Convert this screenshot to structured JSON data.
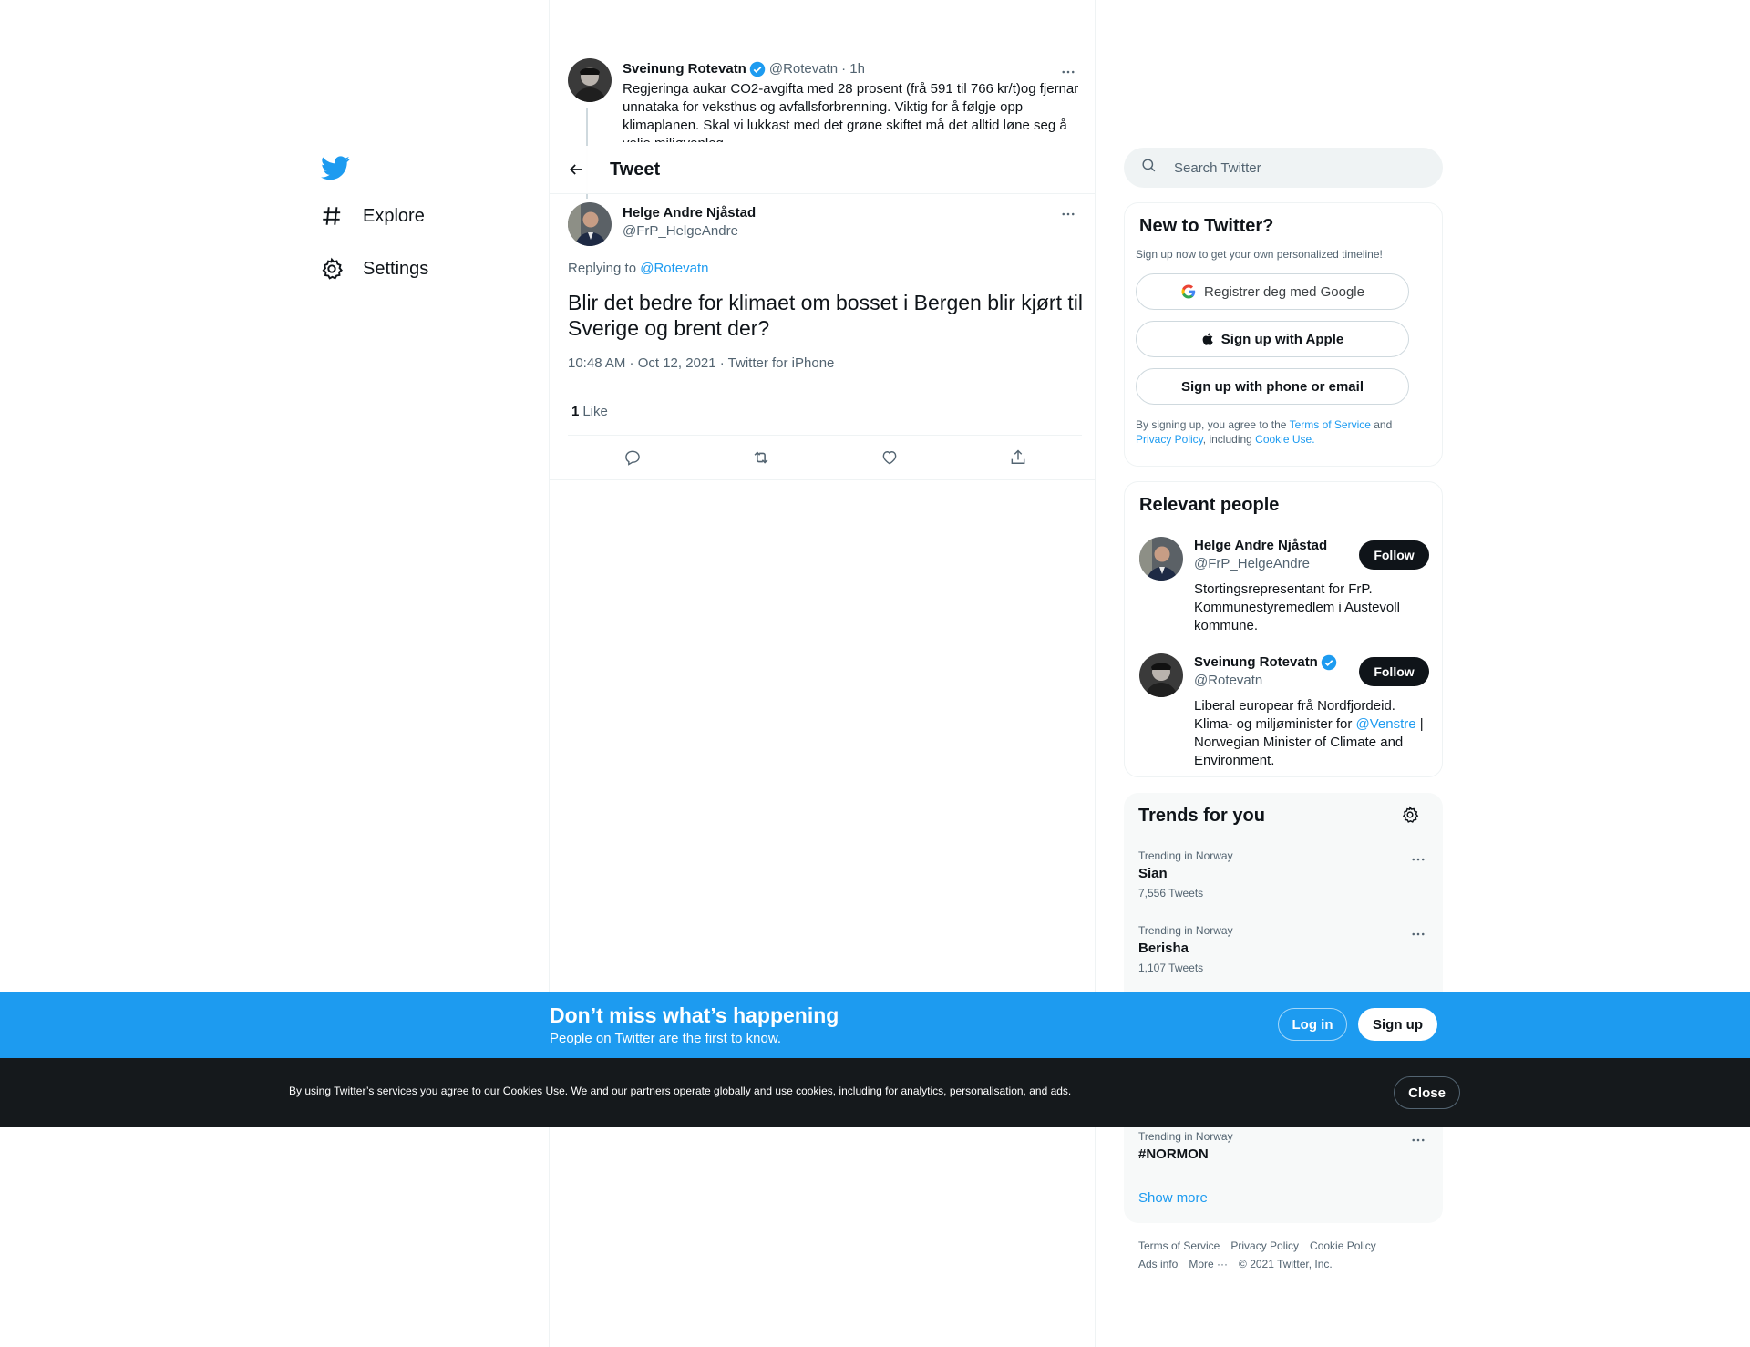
{
  "nav": {
    "items": [
      {
        "label": "Explore",
        "icon": "hash-icon"
      },
      {
        "label": "Settings",
        "icon": "gear-icon"
      }
    ]
  },
  "parent_tweet": {
    "name": "Sveinung Rotevatn",
    "handle": "@Rotevatn",
    "time": "· 1h",
    "text": "Regjeringa aukar CO2-avgifta med 28 prosent (frå 591 til 766 kr/t)og fjernar unnataka for veksthus og avfallsforbrenning. Viktig for å følgje opp klimaplanen. Skal vi lukkast med det grøne skiftet må det alltid løne seg å velje miljøvenleg."
  },
  "header": {
    "title": "Tweet"
  },
  "tweet": {
    "name": "Helge Andre Njåstad",
    "handle": "@FrP_HelgeAndre",
    "replying_prefix": "Replying to ",
    "replying_to": "@Rotevatn",
    "text": "Blir det bedre for klimaet om bosset i Bergen blir kjørt til Sverige og brent der?",
    "timestamp": "10:48 AM · Oct 12, 2021 · Twitter for iPhone",
    "like_count": "1",
    "like_label": "Like"
  },
  "search": {
    "placeholder": "Search Twitter"
  },
  "new_to_twitter": {
    "title": "New to Twitter?",
    "subtitle": "Sign up now to get your own personalized timeline!",
    "google_button": "Registrer deg med Google",
    "apple_button": "Sign up with Apple",
    "phone_button": "Sign up with phone or email",
    "legal_prefix": "By signing up, you agree to the ",
    "terms": "Terms of Service",
    "and": " and",
    "privacy": "Privacy Policy",
    "including": ", including ",
    "cookie": "Cookie Use."
  },
  "relevant_people": {
    "title": "Relevant people",
    "people": [
      {
        "name": "Helge Andre Njåstad",
        "handle": "@FrP_HelgeAndre",
        "bio": "Stortingsrepresentant for FrP. Kommunestyremedlem i Austevoll kommune.",
        "follow": "Follow"
      },
      {
        "name": "Sveinung Rotevatn",
        "handle": "@Rotevatn",
        "bio_prefix": "Liberal europear frå Nordfjordeid. Klima- og miljøminister for ",
        "bio_link": "@Venstre",
        "bio_suffix": " | Norwegian Minister of Climate and Environment.",
        "follow": "Follow"
      }
    ]
  },
  "trends": {
    "title": "Trends for you",
    "items": [
      {
        "context": "Trending in Norway",
        "topic": "Sian",
        "count": "7,556 Tweets"
      },
      {
        "context": "Trending in Norway",
        "topic": "Berisha",
        "count": "1,107 Tweets"
      },
      {
        "context": "Trending in Norway",
        "topic": "#NORMON",
        "count": ""
      }
    ],
    "show_more": "Show more"
  },
  "footer": {
    "links": [
      "Terms of Service",
      "Privacy Policy",
      "Cookie Policy",
      "Ads info",
      "More ···",
      "© 2021 Twitter, Inc."
    ]
  },
  "banner": {
    "heading": "Don’t miss what’s happening",
    "subtitle": "People on Twitter are the first to know.",
    "login": "Log in",
    "signup": "Sign up"
  },
  "cookie_bar": {
    "text": "By using Twitter’s services you agree to our Cookies Use. We and our partners operate globally and use cookies, including for analytics, personalisation, and ads.",
    "close": "Close"
  },
  "colors": {
    "accent": "#1d9bf0",
    "text": "#0f1419",
    "secondary": "#536471",
    "cookie_bg": "#15191c"
  }
}
